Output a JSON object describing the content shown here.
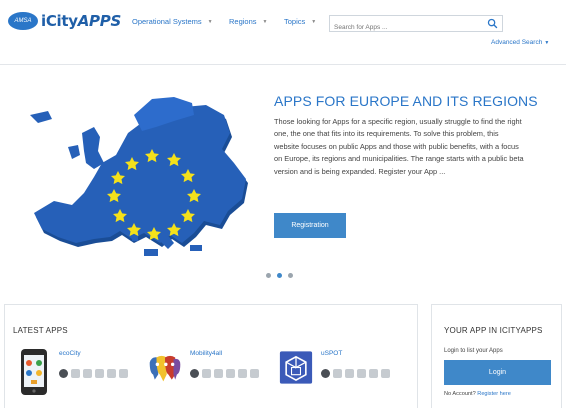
{
  "header": {
    "logo_badge": "AMSA",
    "logo_city": "iCity",
    "logo_apps": "APPS",
    "nav": [
      {
        "label": "Operational Systems"
      },
      {
        "label": "Regions"
      },
      {
        "label": "Topics"
      }
    ],
    "search_placeholder": "Search for Apps ...",
    "advanced_search": "Advanced Search"
  },
  "hero": {
    "title": "APPS FOR EUROPE AND ITS REGIONS",
    "text": "Those looking for Apps for a specific region, usually struggle to find the right one, the one that fits into its requirements. To solve this problem, this website focuses on public Apps and those with public benefits, with a focus on Europe, its regions and municipalities. The range starts with a public beta version and is being expanded. Register your App ...",
    "button": "Registration",
    "carousel_active_index": 1
  },
  "latest_apps": {
    "title": "LATEST APPS",
    "apps": [
      {
        "name": "ecoCity",
        "icon": "phone-app-icon"
      },
      {
        "name": "Mobility4all",
        "icon": "speech-bubbles-app-icon"
      },
      {
        "name": "uSPOT",
        "icon": "cube-app-icon"
      }
    ]
  },
  "your_app": {
    "title": "YOUR APP IN ICITYAPPS",
    "login_prompt": "Login to list your Apps",
    "login_button": "Login",
    "no_account": "No Account?",
    "register_link": "Register here"
  },
  "colors": {
    "accent": "#2a76c8",
    "button": "#3f88c9",
    "map": "#2660b8",
    "star": "#f4e11a"
  }
}
